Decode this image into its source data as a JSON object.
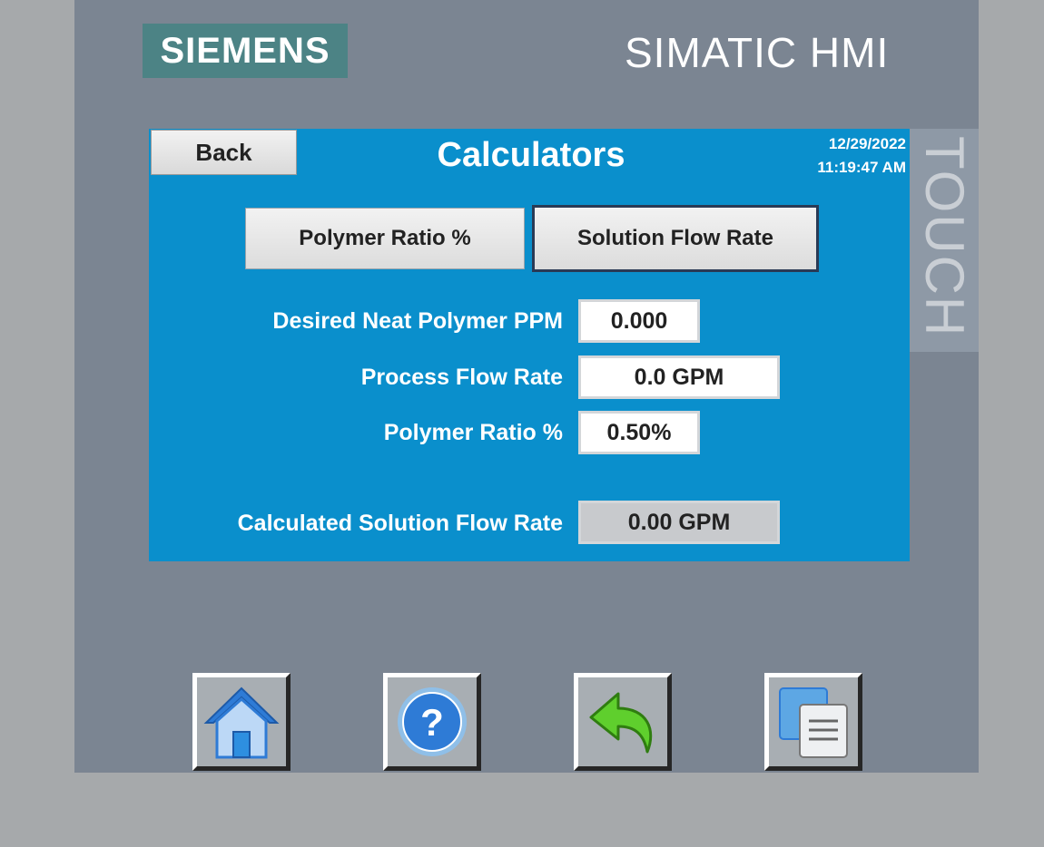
{
  "brand": {
    "logo_text": "SIEMENS",
    "product": "SIMATIC HMI",
    "touch_label": "TOUCH"
  },
  "header": {
    "back_label": "Back",
    "title": "Calculators",
    "date": "12/29/2022",
    "time": "11:19:47 AM"
  },
  "tabs": [
    {
      "label": "Polymer Ratio %",
      "active": false
    },
    {
      "label": "Solution Flow Rate",
      "active": true
    }
  ],
  "form": {
    "neat_ppm": {
      "label": "Desired Neat Polymer PPM",
      "value": "0.000"
    },
    "process_flow": {
      "label": "Process Flow Rate",
      "value": "0.0 GPM"
    },
    "polymer_ratio": {
      "label": "Polymer Ratio %",
      "value": "0.50%"
    },
    "calculated": {
      "label": "Calculated Solution Flow Rate",
      "value": "0.00 GPM"
    }
  },
  "nav_icons": [
    "home-icon",
    "help-icon",
    "return-arrow-icon",
    "screens-icon"
  ],
  "colors": {
    "screen_background": "#0a8fcc",
    "bezel": "#7b8592",
    "logo_background": "#4c8385",
    "outer_frame": "#a6a9ab"
  }
}
